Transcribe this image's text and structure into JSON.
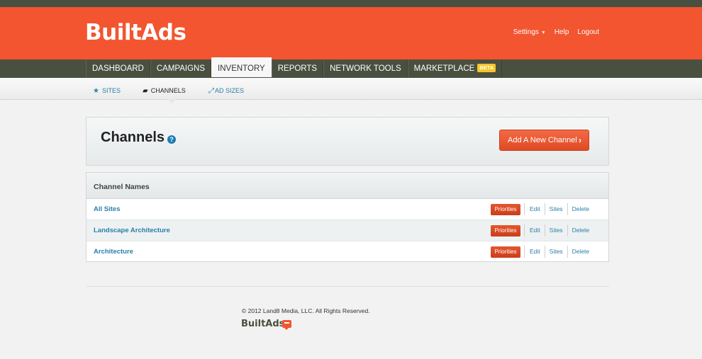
{
  "brand": {
    "name": "BuiltAds",
    "accent": "#f25530",
    "nav_bg": "#4a5040",
    "link": "#2a7fa8"
  },
  "user_nav": {
    "settings": "Settings",
    "help": "Help",
    "logout": "Logout"
  },
  "main_nav": {
    "items": [
      "DASHBOARD",
      "CAMPAIGNS",
      "INVENTORY",
      "REPORTS",
      "NETWORK TOOLS",
      "MARKETPLACE"
    ],
    "active": "INVENTORY",
    "badge": "BETA"
  },
  "sub_nav": {
    "items": [
      {
        "label": "SITES",
        "icon": "star-icon"
      },
      {
        "label": "CHANNELS",
        "icon": "folder-icon"
      },
      {
        "label": "AD SIZES",
        "icon": "resize-icon"
      }
    ],
    "active": "CHANNELS"
  },
  "page": {
    "title": "Channels",
    "help": "?",
    "add_button": "Add A New Channel",
    "add_chevron": "›"
  },
  "table": {
    "header": "Channel Names",
    "actions": {
      "priorities": "Priorities",
      "edit": "Edit",
      "sites": "Sites",
      "delete": "Delete"
    },
    "rows": [
      {
        "name": "All Sites"
      },
      {
        "name": "Landscape Architecture"
      },
      {
        "name": "Architecture"
      }
    ]
  },
  "footer": {
    "copyright": "© 2012 Land8 Media, LLC. All Rights Reserved.",
    "logo": "BuiltAds"
  }
}
